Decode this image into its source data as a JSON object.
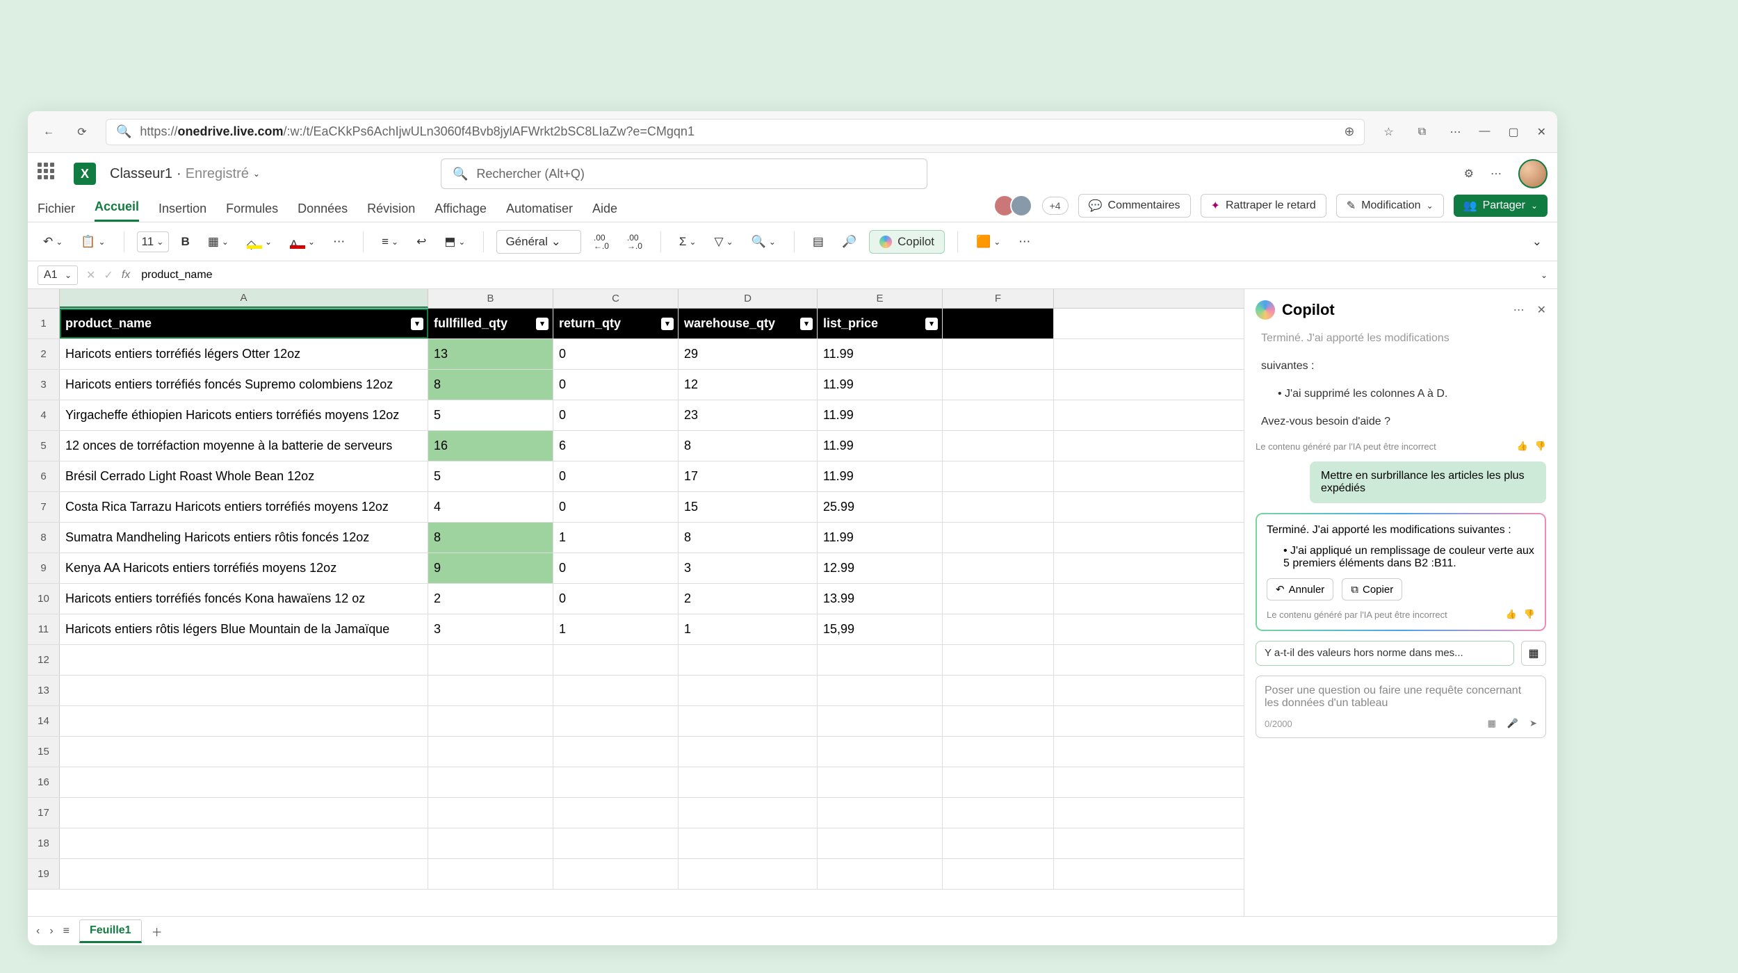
{
  "browser": {
    "url_host": "onedrive.live.com",
    "url_path": "/:w:/t/EaCKkPs6AchIjwULn3060f4Bvb8jylAFWrkt2bSC8LIaZw?e=CMgqn1"
  },
  "titlebar": {
    "doc_name": "Classeur1",
    "saved": "Enregistré",
    "search_placeholder": "Rechercher (Alt+Q)"
  },
  "ribbon_tabs": [
    "Fichier",
    "Accueil",
    "Insertion",
    "Formules",
    "Données",
    "Révision",
    "Affichage",
    "Automatiser",
    "Aide"
  ],
  "ribbon_active": "Accueil",
  "presence_more": "+4",
  "buttons": {
    "comments": "Commentaires",
    "catchup": "Rattraper le retard",
    "editing": "Modification",
    "share": "Partager",
    "copilot": "Copilot"
  },
  "toolbar": {
    "font_size": "11",
    "number_format": "Général"
  },
  "namebox": "A1",
  "formula": "product_name",
  "columns": [
    "A",
    "B",
    "C",
    "D",
    "E",
    "F"
  ],
  "headers": [
    "product_name",
    "fullfilled_qty",
    "return_qty",
    "warehouse_qty",
    "list_price"
  ],
  "rows": [
    {
      "n": 2,
      "a": "Haricots entiers torréfiés légers Otter 12oz",
      "b": "13",
      "c": "0",
      "d": "29",
      "e": "11.99",
      "hl": true
    },
    {
      "n": 3,
      "a": "Haricots entiers torréfiés foncés Supremo colombiens 12oz",
      "b": "8",
      "c": "0",
      "d": "12",
      "e": "11.99",
      "hl": true
    },
    {
      "n": 4,
      "a": "Yirgacheffe éthiopien Haricots entiers torréfiés moyens 12oz",
      "b": "5",
      "c": "0",
      "d": "23",
      "e": "11.99",
      "hl": false
    },
    {
      "n": 5,
      "a": "12 onces de torréfaction moyenne à la batterie de serveurs",
      "b": "16",
      "c": "6",
      "d": "8",
      "e": "11.99",
      "hl": true
    },
    {
      "n": 6,
      "a": "Brésil Cerrado Light Roast Whole Bean 12oz",
      "b": "5",
      "c": "0",
      "d": "17",
      "e": "11.99",
      "hl": false
    },
    {
      "n": 7,
      "a": "Costa Rica Tarrazu Haricots entiers torréfiés moyens 12oz",
      "b": "4",
      "c": "0",
      "d": "15",
      "e": "25.99",
      "hl": false
    },
    {
      "n": 8,
      "a": "Sumatra Mandheling Haricots entiers rôtis foncés 12oz",
      "b": "8",
      "c": "1",
      "d": "8",
      "e": "11.99",
      "hl": true
    },
    {
      "n": 9,
      "a": "Kenya AA Haricots entiers torréfiés moyens 12oz",
      "b": "9",
      "c": "0",
      "d": "3",
      "e": "12.99",
      "hl": true
    },
    {
      "n": 10,
      "a": "Haricots entiers torréfiés foncés Kona hawaïens 12 oz",
      "b": "2",
      "c": "0",
      "d": "2",
      "e": "13.99",
      "hl": false
    },
    {
      "n": 11,
      "a": "Haricots entiers rôtis légers Blue Mountain de la Jamaïque",
      "b": "3",
      "c": "1",
      "d": "1",
      "e": "15,99",
      "hl": false
    }
  ],
  "empty_rows": [
    12,
    13,
    14,
    15,
    16,
    17,
    18,
    19
  ],
  "sheet": {
    "name": "Feuille1"
  },
  "copilot": {
    "title": "Copilot",
    "prev_trunc": "Terminé. J'ai apporté les modifications",
    "prev_line2": "suivantes :",
    "prev_bullet": "J'ai supprimé les colonnes A à D.",
    "prev_followup": "Avez-vous besoin d'aide ?",
    "disclaimer": "Le contenu généré par l'IA peut être incorrect",
    "user_msg": "Mettre en surbrillance les articles les plus expédiés",
    "ai_header": "Terminé. J'ai apporté les modifications suivantes :",
    "ai_bullet": "J'ai appliqué un remplissage de couleur verte aux 5 premiers éléments dans B2 :B11.",
    "undo": "Annuler",
    "copy": "Copier",
    "suggestion": "Y a-t-il des valeurs hors norme dans mes...",
    "input_placeholder": "Poser une question ou faire une requête concernant les données d'un tableau",
    "counter": "0/2000"
  }
}
